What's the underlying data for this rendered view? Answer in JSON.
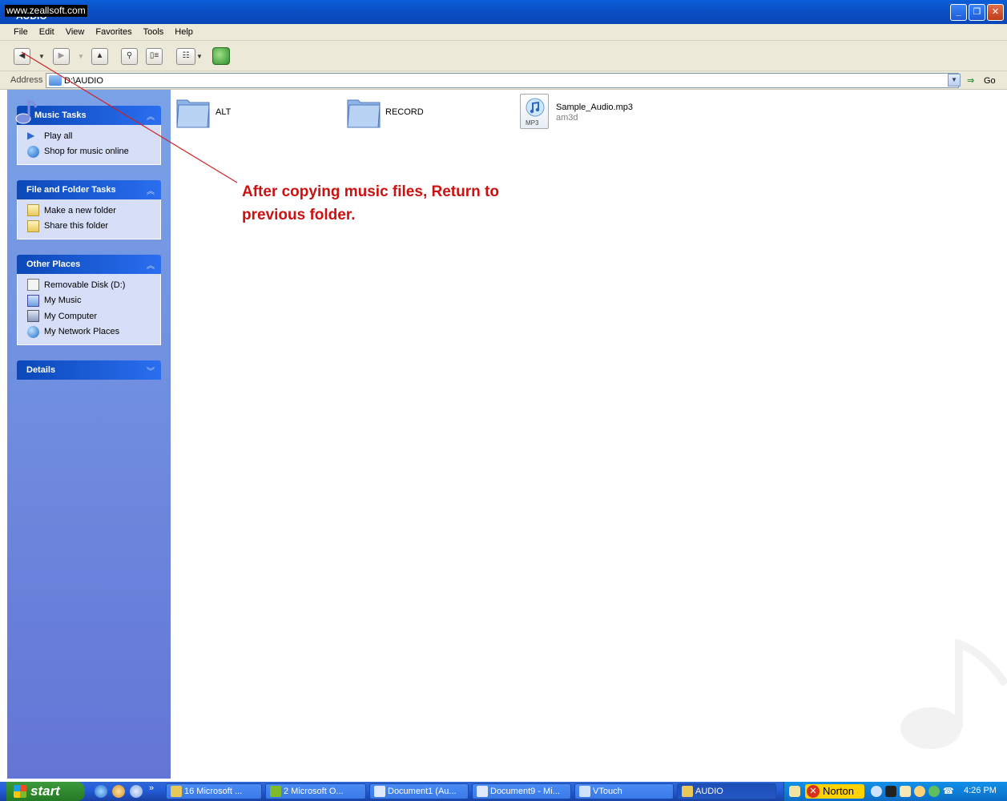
{
  "window": {
    "title": "AUDIO",
    "watermark": "www.zeallsoft.com"
  },
  "menu": [
    "File",
    "Edit",
    "View",
    "Favorites",
    "Tools",
    "Help"
  ],
  "address": {
    "label": "Address",
    "path": "D:\\AUDIO",
    "go_label": "Go"
  },
  "tasks": {
    "music_tasks": {
      "title": "Music Tasks",
      "items": [
        "Play all",
        "Shop for music online"
      ]
    },
    "file_folder_tasks": {
      "title": "File and Folder Tasks",
      "items": [
        "Make a new folder",
        "Share this folder"
      ]
    },
    "other_places": {
      "title": "Other Places",
      "items": [
        "Removable Disk (D:)",
        "My Music",
        "My Computer",
        "My Network Places"
      ]
    },
    "details": {
      "title": "Details"
    }
  },
  "files": [
    {
      "name": "ALT",
      "type": "folder"
    },
    {
      "name": "RECORD",
      "type": "folder"
    },
    {
      "name": "Sample_Audio.mp3",
      "subtitle": "am3d",
      "type": "mp3",
      "icon_tag": "MP3"
    }
  ],
  "annotation": {
    "line1": "After copying music files, Return to",
    "line2": "previous folder."
  },
  "taskbar": {
    "start_label": "start",
    "buttons": [
      "16 Microsoft ...",
      "2 Microsoft O...",
      "Document1 (Au...",
      "Document9 - Mi...",
      "VTouch",
      "AUDIO"
    ],
    "norton_label": "Norton",
    "clock": "4:26 PM"
  },
  "colors": {
    "annotation_red": "#cc1111",
    "taskpane_blue": "#6375d6",
    "titlebar_blue": "#0a4ec4",
    "start_green": "#2f8a2f"
  }
}
